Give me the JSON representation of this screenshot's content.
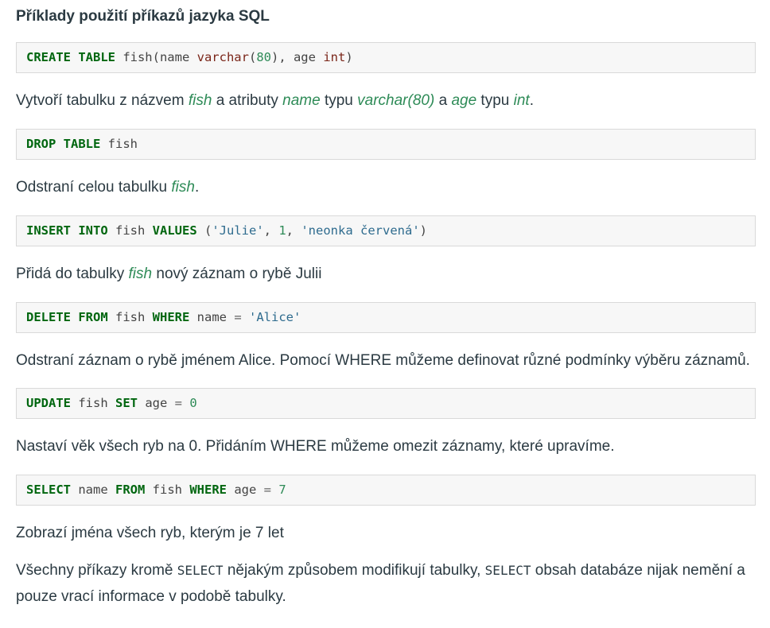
{
  "heading": "Příklady použití příkazů jazyka SQL",
  "examples": [
    {
      "code": {
        "k1": "CREATE TABLE",
        "t1": " fish(name ",
        "ty1": "varchar",
        "t2": "(",
        "n1": "80",
        "t3": "), age ",
        "ty2": "int",
        "t4": ")"
      },
      "desc": {
        "a": "Vytvoří tabulku z názvem ",
        "fish": "fish",
        "b": " a atributy ",
        "name": "name",
        "c": " typu ",
        "varchar": "varchar(80)",
        "d": " a ",
        "age": "age",
        "e": " typu ",
        "int": "int",
        "f": "."
      }
    },
    {
      "code": {
        "k1": "DROP TABLE",
        "t1": " fish"
      },
      "desc": {
        "a": "Odstraní celou tabulku ",
        "fish": "fish",
        "b": "."
      }
    },
    {
      "code": {
        "k1": "INSERT INTO",
        "t1": " fish ",
        "k2": "VALUES",
        "t2": " (",
        "s1": "'Julie'",
        "t3": ", ",
        "n1": "1",
        "t4": ", ",
        "s2": "'neonka červená'",
        "t5": ")"
      },
      "desc": {
        "a": "Přidá do tabulky ",
        "fish": "fish",
        "b": " nový záznam o rybě Julii"
      }
    },
    {
      "code": {
        "k1": "DELETE FROM",
        "t1": " fish ",
        "k2": "WHERE",
        "t2": " name ",
        "op": "=",
        "t3": " ",
        "s1": "'Alice'"
      },
      "desc": "Odstraní záznam o rybě jménem Alice. Pomocí WHERE můžeme definovat různé podmínky výběru záznamů."
    },
    {
      "code": {
        "k1": "UPDATE",
        "t1": " fish ",
        "k2": "SET",
        "t2": " age ",
        "op": "=",
        "t3": " ",
        "n1": "0"
      },
      "desc": "Nastaví věk všech ryb na 0. Přidáním WHERE můžeme omezit záznamy, které upravíme."
    },
    {
      "code": {
        "k1": "SELECT",
        "t1": " name ",
        "k2": "FROM",
        "t2": " fish ",
        "k3": "WHERE",
        "t3": " age ",
        "op": "=",
        "t4": " ",
        "n1": "7"
      },
      "desc": "Zobrazí jména všech ryb, kterým je 7 let"
    }
  ],
  "summary": {
    "a": "Všechny příkazy kromě ",
    "code1": "SELECT",
    "b": " nějakým způsobem modifikují tabulky, ",
    "code2": "SELECT",
    "c": " obsah databáze nijak nemění a pouze vrací informace v podobě tabulky."
  },
  "colors": {
    "keyword": "#00660f",
    "type": "#7a2518",
    "number": "#2e8b57",
    "highlight": "#2e8b57",
    "code_bg": "#f7f7f7",
    "code_border": "#d9d9d9"
  }
}
